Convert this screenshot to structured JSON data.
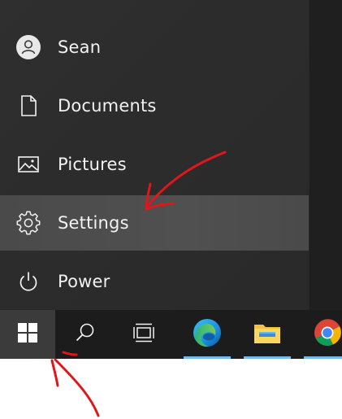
{
  "start_menu": {
    "items": [
      {
        "label": "Sean",
        "icon": "user-avatar-icon"
      },
      {
        "label": "Documents",
        "icon": "document-icon"
      },
      {
        "label": "Pictures",
        "icon": "pictures-icon"
      },
      {
        "label": "Settings",
        "icon": "gear-icon"
      },
      {
        "label": "Power",
        "icon": "power-icon"
      }
    ],
    "active_item": "Settings"
  },
  "taskbar": {
    "buttons": [
      {
        "name": "start",
        "icon": "windows-logo-icon"
      },
      {
        "name": "search",
        "icon": "search-icon"
      },
      {
        "name": "task-view",
        "icon": "task-view-icon"
      },
      {
        "name": "edge",
        "icon": "edge-icon",
        "running": true
      },
      {
        "name": "file-explorer",
        "icon": "folder-icon",
        "running": true
      },
      {
        "name": "chrome",
        "icon": "chrome-icon",
        "running": true
      }
    ],
    "running_indicator_color": "#76b9ed"
  },
  "annotations": {
    "arrow_color": "#e0161b"
  }
}
